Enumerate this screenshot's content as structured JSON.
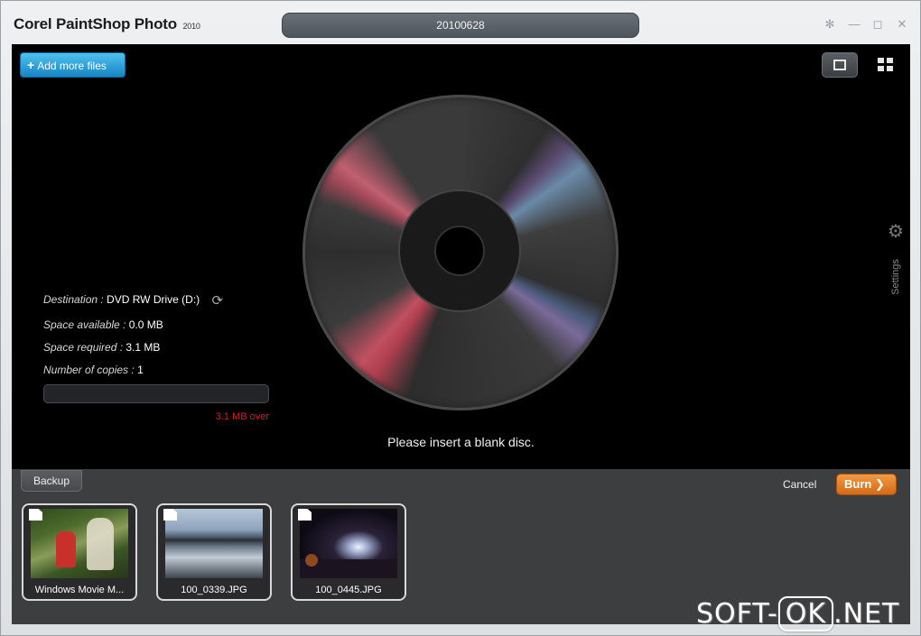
{
  "app": {
    "title": "Corel PaintShop Photo",
    "version": "2010",
    "project_name": "20100628"
  },
  "window_controls": {
    "help_icon": "✻",
    "minimize_icon": "—",
    "maximize_icon": "◻",
    "close_icon": "✕"
  },
  "toolbar": {
    "add_files_label": "Add more files",
    "add_files_icon": "+",
    "settings_label": "Settings",
    "settings_icon": "⚙"
  },
  "destination": {
    "destination_key": "Destination :",
    "destination_value": "DVD RW Drive (D:)",
    "space_available_key": "Space available :",
    "space_available_value": "0.0 MB",
    "space_required_key": "Space required :",
    "space_required_value": "3.1 MB",
    "copies_key": "Number of copies :",
    "copies_value": "1",
    "over_text": "3.1  MB over",
    "fill_fraction": 0
  },
  "status": {
    "message": "Please insert a blank disc."
  },
  "bottom_bar": {
    "backup_tab": "Backup",
    "cancel_label": "Cancel",
    "burn_label": "Burn",
    "burn_icon": "❯"
  },
  "files": [
    {
      "caption": "Windows Movie M..."
    },
    {
      "caption": "100_0339.JPG"
    },
    {
      "caption": "100_0445.JPG"
    }
  ],
  "watermark": {
    "prefix": "SOFT-",
    "boxed": "OK",
    "suffix": ".NET"
  }
}
